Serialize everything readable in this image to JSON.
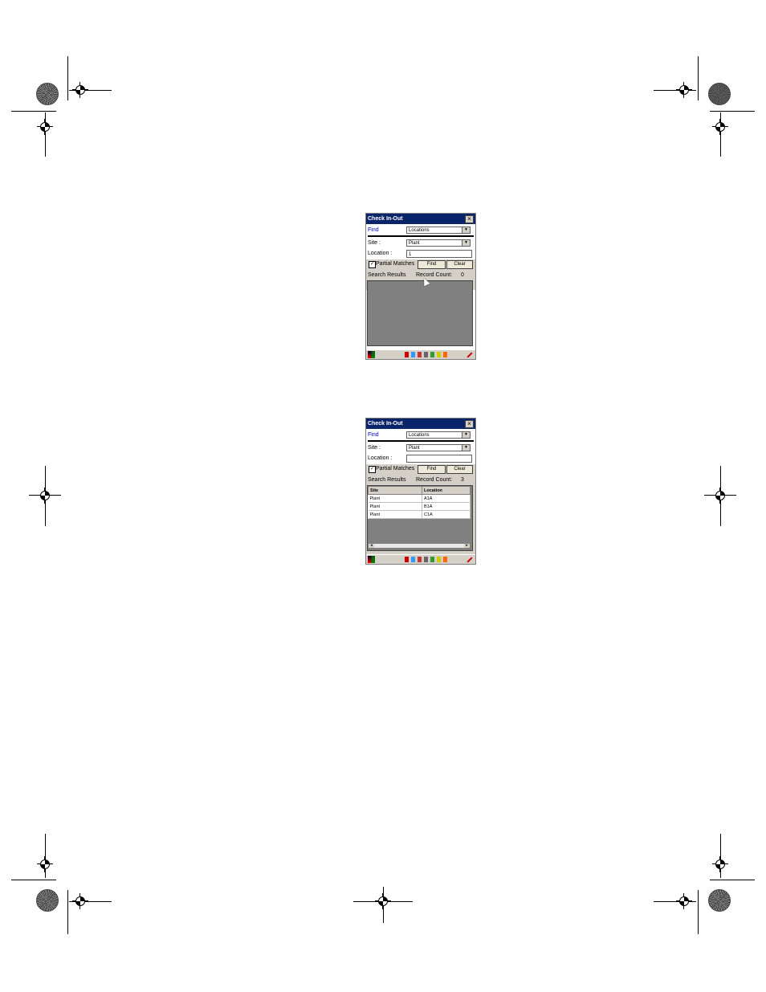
{
  "screens": [
    {
      "title": "Check In-Out",
      "close": "×",
      "find_label": "Find",
      "find_select": "Locations",
      "site_label": "Site :",
      "site_select": "Plant",
      "location_label": "Location :",
      "location_value": "1",
      "partial_matches_label": "Partial Matches",
      "partial_matches_checked": "✓",
      "find_button": "Find",
      "clear_button": "Clear",
      "search_results_label": "Search Results",
      "record_count_label": "Record Count:",
      "record_count": "0"
    },
    {
      "title": "Check In-Out",
      "close": "×",
      "find_label": "Find",
      "find_select": "Locations",
      "site_label": "Site :",
      "site_select": "Plant",
      "location_label": "Location :",
      "location_value": "",
      "partial_matches_label": "Partial Matches",
      "partial_matches_checked": "✓",
      "find_button": "Find",
      "clear_button": "Clear",
      "search_results_label": "Search Results",
      "record_count_label": "Record Count:",
      "record_count": "3",
      "table": {
        "headers": [
          "Site",
          "Location"
        ],
        "rows": [
          [
            "Plant",
            "A1A"
          ],
          [
            "Plant",
            "B1A"
          ],
          [
            "Plant",
            "C1A"
          ]
        ]
      }
    }
  ],
  "icons": {
    "dropdown_arrow": "▼",
    "scroll_left": "◂",
    "scroll_right": "▸"
  }
}
